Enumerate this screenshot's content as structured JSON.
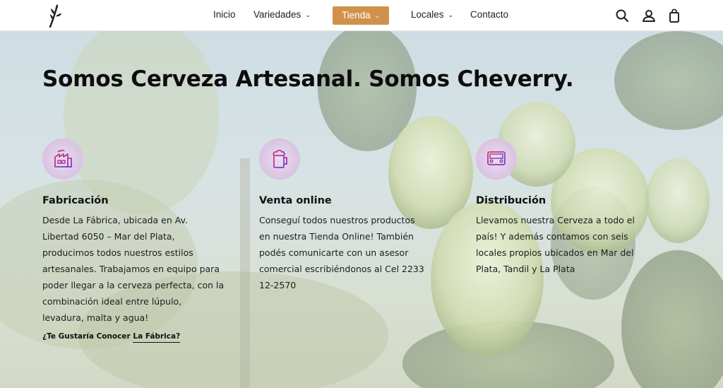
{
  "nav": {
    "items": [
      {
        "label": "Inicio",
        "caret": ""
      },
      {
        "label": "Variedades",
        "caret": "⌄"
      },
      {
        "label": "Tienda",
        "caret": "⌄"
      },
      {
        "label": "Locales",
        "caret": "⌄"
      },
      {
        "label": "Contacto",
        "caret": ""
      }
    ],
    "active_color": "#d0924a"
  },
  "icons": {
    "logo": "wheat-logo-icon",
    "search": "search-icon",
    "account": "user-icon",
    "cart": "shopping-bag-icon"
  },
  "hero": {
    "headline": "Somos Cerveza Artesanal. Somos Cheverry.",
    "features": [
      {
        "icon": "factory-icon",
        "title": "Fabricación",
        "text": "Desde La Fábrica, ubicada en Av. Libertad 6050 – Mar del Plata, producimos todos nuestros estilos artesanales. Trabajamos en equipo para poder llegar a la cerveza perfecta, con la combinación ideal entre lúpulo, levadura, malta y agua!"
      },
      {
        "icon": "beer-mug-icon",
        "title": "Venta online",
        "text": "Conseguí todos nuestros productos en nuestra Tienda Online! También podés comunicarte con un asesor comercial escribiéndonos al Cel 2233 12-2570"
      },
      {
        "icon": "truck-icon",
        "title": "Distribución",
        "text": "Llevamos nuestra Cerveza a todo el país! Y además contamos con seis locales propios ubicados en Mar del Plata, Tandil y La Plata"
      }
    ],
    "cta_prefix": "¿Te Gustaría Conocer",
    "cta_link": "La Fábrica?"
  }
}
